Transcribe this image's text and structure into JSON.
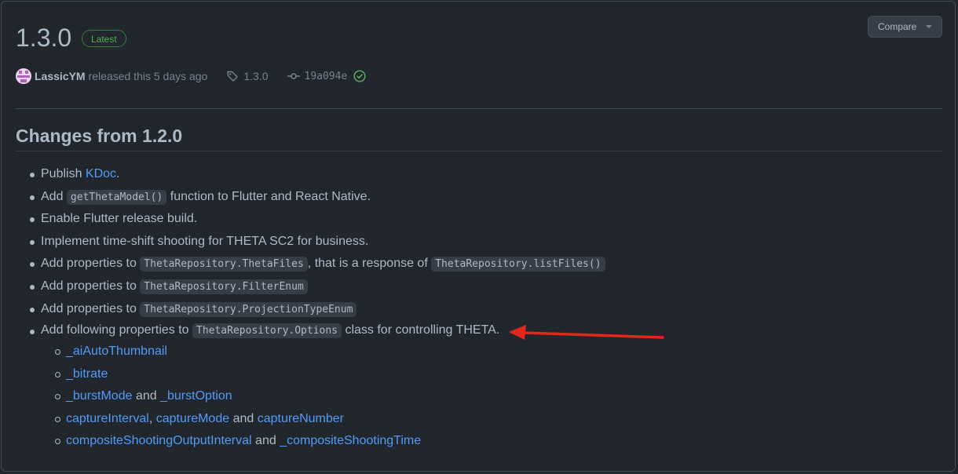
{
  "release": {
    "version": "1.3.0",
    "badge": "Latest",
    "compare_label": "Compare",
    "author": "LassicYM",
    "released_text": "released this 5 days ago",
    "tag": "1.3.0",
    "commit": "19a094e"
  },
  "notes": {
    "heading": "Changes from 1.2.0",
    "items": [
      {
        "pre": "Publish ",
        "link": "KDoc",
        "post": "."
      },
      {
        "pre": "Add ",
        "code": "getThetaModel()",
        "post": " function to Flutter and React Native."
      },
      {
        "text": "Enable Flutter release build."
      },
      {
        "text": "Implement time-shift shooting for THETA SC2 for business."
      },
      {
        "pre": "Add properties to ",
        "code": "ThetaRepository.ThetaFiles",
        "mid": ", that is a response of ",
        "code2": "ThetaRepository.listFiles()"
      },
      {
        "pre": "Add properties to ",
        "code": "ThetaRepository.FilterEnum"
      },
      {
        "pre": "Add properties to ",
        "code": "ThetaRepository.ProjectionTypeEnum"
      },
      {
        "pre": "Add following properties to ",
        "code": "ThetaRepository.Options",
        "post": " class for controlling THETA."
      }
    ],
    "subitems": {
      "s0": {
        "l1": "_aiAutoThumbnail"
      },
      "s1": {
        "l1": "_bitrate"
      },
      "s2": {
        "l1": "_burstMode",
        "t1": " and ",
        "l2": "_burstOption"
      },
      "s3": {
        "l1": "captureInterval",
        "t1": ", ",
        "l2": "captureMode",
        "t2": " and ",
        "l3": "captureNumber"
      },
      "s4": {
        "l1": "compositeShootingOutputInterval",
        "t1": " and ",
        "l2": "_compositeShootingTime"
      }
    }
  },
  "colors": {
    "background": "#22272e",
    "link": "#539bf5",
    "badge_green": "#57ab5a",
    "annotation_arrow": "#e5261c"
  },
  "icons": [
    "tag-icon",
    "git-commit-icon",
    "check-circle-icon",
    "chevron-down-icon"
  ]
}
